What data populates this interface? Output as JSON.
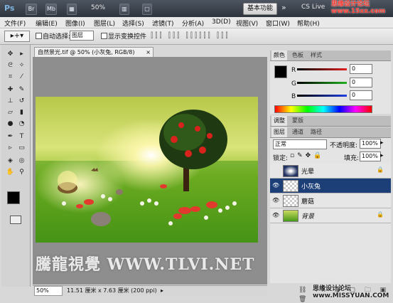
{
  "appbar": {
    "logo": "Ps",
    "zoom": "50%",
    "workspace": "基本功能",
    "cs_live": "CS Live",
    "watermark": "思缘设计论坛 www.15xx.com"
  },
  "menu": [
    "文件(F)",
    "编辑(E)",
    "图像(I)",
    "图层(L)",
    "选择(S)",
    "滤镜(T)",
    "分析(A)",
    "3D(D)",
    "视图(V)",
    "窗口(W)",
    "帮助(H)"
  ],
  "options": {
    "auto_select_label": "自动选择:",
    "auto_select_value": "图层",
    "show_transform_label": "显示变换控件"
  },
  "document": {
    "tab_title": "自然景光.tif @ 50% (小灰兔, RGB/8)",
    "status_zoom": "50%",
    "status_info": "11.51 厘米 x 7.63 厘米 (200 ppi)"
  },
  "color_panel": {
    "tabs": [
      "颜色",
      "色板",
      "样式"
    ],
    "channels": [
      {
        "label": "R",
        "value": "0",
        "color": "#e02020"
      },
      {
        "label": "G",
        "value": "0",
        "color": "#20b020"
      },
      {
        "label": "B",
        "value": "0",
        "color": "#2040e0"
      }
    ]
  },
  "adjust_panel": {
    "tabs": [
      "调整",
      "蒙版"
    ]
  },
  "layers_panel": {
    "tabs": [
      "图层",
      "通道",
      "路径"
    ],
    "blend_mode": "正常",
    "opacity_label": "不透明度:",
    "opacity": "100%",
    "lock_label": "锁定:",
    "fill_label": "填充:",
    "fill": "100%",
    "layers": [
      {
        "name": "光晕",
        "visible": false,
        "selected": false,
        "locked": true
      },
      {
        "name": "小灰兔",
        "visible": true,
        "selected": true,
        "locked": false
      },
      {
        "name": "蘑菇",
        "visible": true,
        "selected": false,
        "locked": false
      },
      {
        "name": "背景",
        "visible": true,
        "selected": false,
        "locked": true
      }
    ]
  },
  "watermarks": {
    "canvas": "騰龍視覺 WWW.TLVI.NET",
    "bottom": "思缘设计论坛 www.MISSYUAN.COM"
  }
}
